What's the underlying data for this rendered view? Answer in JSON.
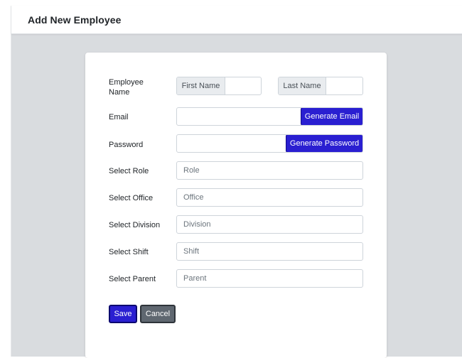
{
  "header": {
    "title": "Add New Employee"
  },
  "form": {
    "employee_name_label": "Employee\nName",
    "first_name_addon": "First Name",
    "first_name_value": "",
    "last_name_addon": "Last Name",
    "last_name_value": "",
    "email_label": "Email",
    "email_value": "",
    "generate_email_label": "Generate Email",
    "password_label": "Password",
    "password_value": "",
    "generate_password_label": "Generate Password",
    "role_label": "Select Role",
    "role_placeholder": "Role",
    "office_label": "Select Office",
    "office_placeholder": "Office",
    "division_label": "Select Division",
    "division_placeholder": "Division",
    "shift_label": "Select Shift",
    "shift_placeholder": "Shift",
    "parent_label": "Select Parent",
    "parent_placeholder": "Parent"
  },
  "actions": {
    "save_label": "Save",
    "cancel_label": "Cancel"
  },
  "colors": {
    "primary": "#2a1fd1",
    "secondary": "#5f6770",
    "background": "#d9dcdf"
  }
}
